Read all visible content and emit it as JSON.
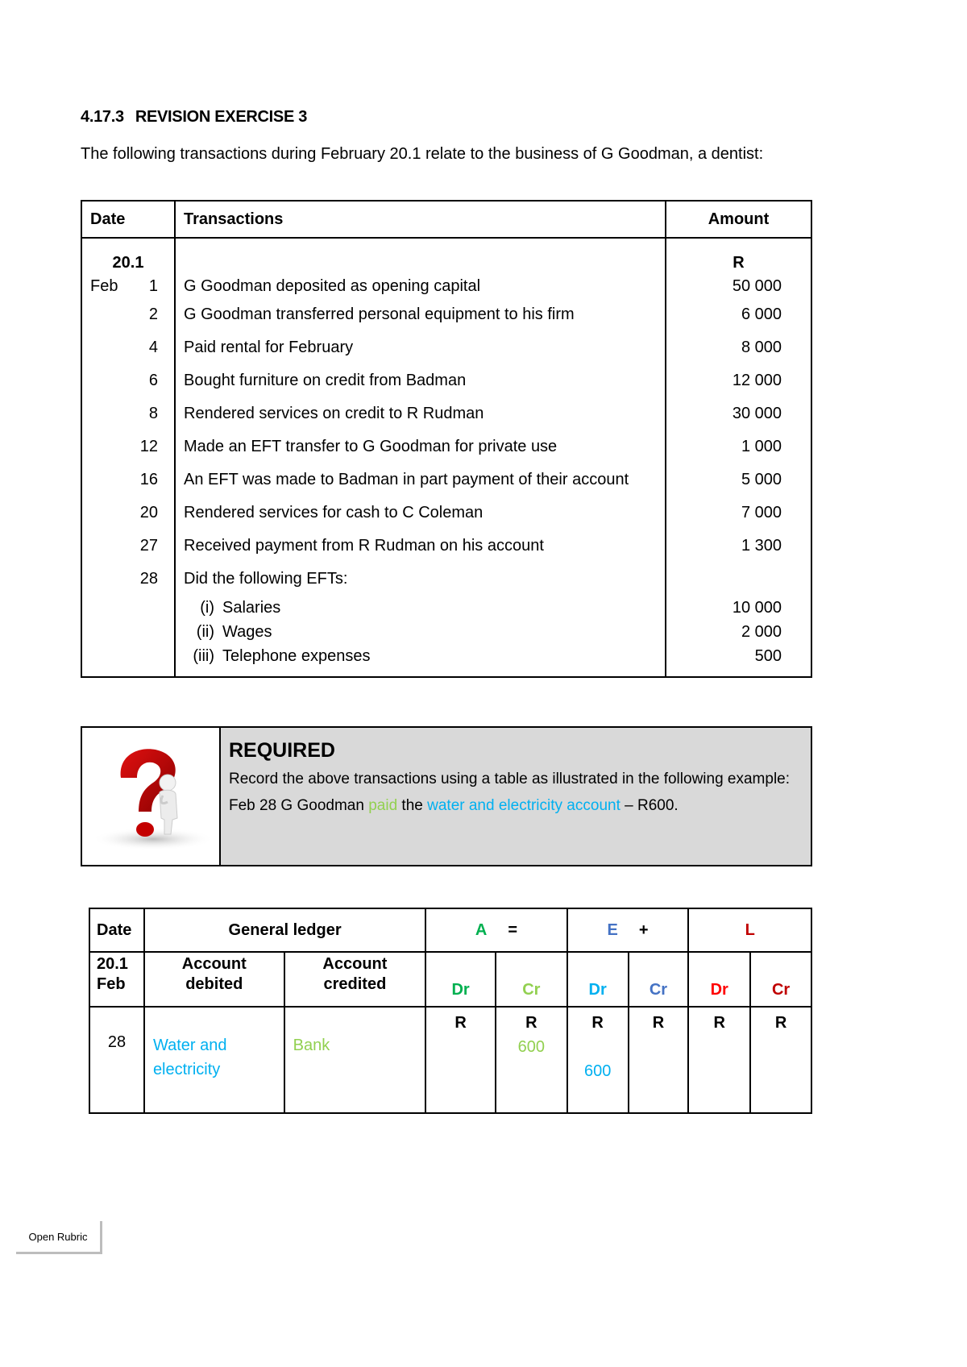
{
  "heading": {
    "number": "4.17.3",
    "title": "REVISION EXERCISE 3"
  },
  "intro": "The following transactions during February 20.1 relate to the business of G Goodman, a dentist:",
  "transactions_table": {
    "headers": {
      "date": "Date",
      "transactions": "Transactions",
      "amount": "Amount"
    },
    "year": "20.1",
    "currency": "R",
    "month": "Feb",
    "rows": [
      {
        "day": "1",
        "description": "G Goodman deposited as opening capital",
        "amount": "50 000"
      },
      {
        "day": "2",
        "description": "G Goodman transferred personal equipment to his firm",
        "amount": "6 000"
      },
      {
        "day": "4",
        "description": "Paid rental for February",
        "amount": "8 000"
      },
      {
        "day": "6",
        "description": "Bought furniture on credit from Badman",
        "amount": "12 000"
      },
      {
        "day": "8",
        "description": "Rendered services on credit to R Rudman",
        "amount": "30 000"
      },
      {
        "day": "12",
        "description": "Made an EFT transfer to G Goodman for private use",
        "amount": "1 000"
      },
      {
        "day": "16",
        "description": "An EFT was made to Badman in part payment of their account",
        "amount": "5 000"
      },
      {
        "day": "20",
        "description": "Rendered services for cash to C Coleman",
        "amount": "7 000"
      },
      {
        "day": "27",
        "description": "Received payment from R Rudman on his account",
        "amount": "1 300"
      },
      {
        "day": "28",
        "description": "Did the following EFTs:",
        "amount": ""
      }
    ],
    "sub_items": [
      {
        "index": "(i)",
        "description": "Salaries",
        "amount": "10 000"
      },
      {
        "index": "(ii)",
        "description": "Wages",
        "amount": "2 000"
      },
      {
        "index": "(iii)",
        "description": "Telephone expenses",
        "amount": "500"
      }
    ]
  },
  "required": {
    "icon": "question-mark-figure-icon",
    "title": "REQUIRED",
    "text": "Record the above transactions using a table as illustrated in the following example:",
    "example": {
      "part1": "Feb 28 G Goodman ",
      "paid": "paid",
      "part2": " the ",
      "account": "water and electricity account",
      "part3": " – R600."
    }
  },
  "ledger_table": {
    "headers": {
      "date": "Date",
      "general_ledger": "General ledger",
      "A": "A",
      "eq": "=",
      "E": "E",
      "plus": "+",
      "L": "L",
      "year": "20.1",
      "month": "Feb",
      "account_debited": [
        "Account",
        "debited"
      ],
      "account_credited": [
        "Account",
        "credited"
      ],
      "dr": "Dr",
      "cr": "Cr"
    },
    "colors": {
      "A_Dr": "#00b050",
      "A_Cr": "#92d050",
      "E_Dr": "#00b0f0",
      "E_Cr": "#4472c4",
      "L_Dr": "#ff0000",
      "L_Cr": "#c00000"
    },
    "row": {
      "day": "28",
      "account_debited": [
        "Water and",
        "electricity"
      ],
      "account_credited": "Bank",
      "currency": "R",
      "A_Dr": "",
      "A_Cr": "600",
      "E_Dr": "600",
      "E_Cr": "",
      "L_Dr": "",
      "L_Cr": ""
    }
  },
  "footer": {
    "label": "Open Rubric"
  }
}
